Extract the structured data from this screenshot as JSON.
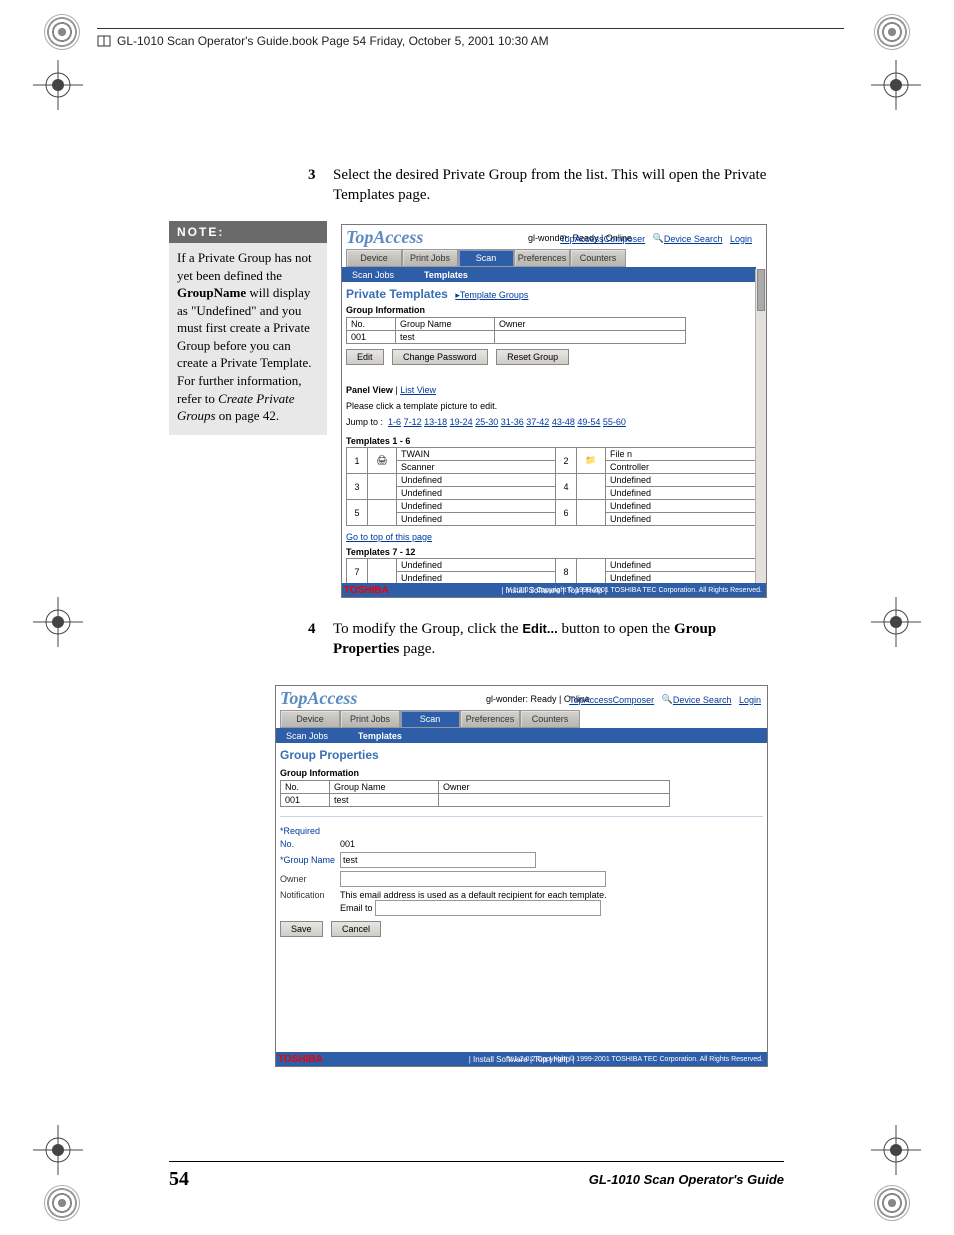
{
  "header": {
    "text": "GL-1010 Scan Operator's Guide.book   Page 54   Friday, October 5, 2001   10:30 AM"
  },
  "note": {
    "title": "NOTE:",
    "body_1": "If a Private Group has not yet been defined the ",
    "body_bold1": "GroupName",
    "body_2": " will display as \"Undefined\" and you must first create a Private Group before you can create a Private Template. For further information, refer to ",
    "body_italic": "Create Private Groups",
    "body_3": " on page 42."
  },
  "step3": {
    "num": "3",
    "text": "Select the desired Private Group from the list. This will open the Private Templates page."
  },
  "step4": {
    "num": "4",
    "text_a": "To modify the Group, click the ",
    "text_btn": "Edit...",
    "text_b": " button to open the ",
    "text_bold": "Group Properties",
    "text_c": " page."
  },
  "screenshot1": {
    "brand": "TopAccess",
    "status": "gl-wonder: Ready | Online",
    "composer": "TopAccessComposer",
    "device_search": "Device Search",
    "login": "Login",
    "tabs": {
      "device": "Device",
      "print": "Print Jobs",
      "scan": "Scan",
      "pref": "Preferences",
      "counters": "Counters"
    },
    "subtabs": {
      "scanjobs": "Scan Jobs",
      "templates": "Templates"
    },
    "title": "Private Templates",
    "back_link": "▸Template Groups",
    "group_info": "Group Information",
    "gi_h_no": "No.",
    "gi_h_name": "Group Name",
    "gi_h_owner": "Owner",
    "gi_no": "001",
    "gi_name": "test",
    "gi_owner": "",
    "btn_edit": "Edit",
    "btn_cpw": "Change Password",
    "btn_reset": "Reset Group",
    "panel_view": "Panel View",
    "list_view": "List View",
    "instr": "Please click a template picture to edit.",
    "jump": "Jump to :",
    "jump_links": [
      "1-6",
      "7-12",
      "13-18",
      "19-24",
      "25-30",
      "31-36",
      "37-42",
      "43-48",
      "49-54",
      "55-60"
    ],
    "tpl16": "Templates  1 - 6",
    "tpl712": "Templates  7 - 12",
    "r1a": "TWAIN",
    "r1b": "Scanner",
    "r2a": "File n",
    "r2b": "Controller",
    "r3a": "Undefined",
    "r3b": "Undefined",
    "r4a": "Undefined",
    "r4b": "Undefined",
    "r5a": "Undefined",
    "r5b": "Undefined",
    "r6a": "Undefined",
    "r6b": "Undefined",
    "gototop": "Go to top of this page",
    "r7a": "Undefined",
    "r7b": "Undefined",
    "r8a": "Undefined",
    "r8b": "Undefined",
    "footer_links": "|  Install Software  |  Top  |  Help  |",
    "copyright": "V.1.2.0.2  Copyright © 1999-2001 TOSHIBA TEC Corporation. All Rights Reserved.",
    "toshiba": "TOSHIBA"
  },
  "screenshot2": {
    "brand": "TopAccess",
    "status": "gl-wonder: Ready | Online",
    "composer": "TopAccessComposer",
    "device_search": "Device Search",
    "login": "Login",
    "tabs": {
      "device": "Device",
      "print": "Print Jobs",
      "scan": "Scan",
      "pref": "Preferences",
      "counters": "Counters"
    },
    "subtabs": {
      "scanjobs": "Scan Jobs",
      "templates": "Templates"
    },
    "title": "Group Properties",
    "group_info": "Group Information",
    "gi_h_no": "No.",
    "gi_h_name": "Group Name",
    "gi_h_owner": "Owner",
    "gi_no": "001",
    "gi_name": "test",
    "gi_owner": "",
    "required": "*Required",
    "f_no_l": "No.",
    "f_no_v": "001",
    "f_name_l": "*Group Name",
    "f_name_v": "test",
    "f_owner_l": "Owner",
    "f_owner_v": "",
    "f_notif_l": "Notification",
    "f_notif_txt": "This email address is used as a default recipient for each template.",
    "f_email_l": "Email to",
    "btn_save": "Save",
    "btn_cancel": "Cancel",
    "footer_links": "|  Install Software  |  Top  |  Help  |",
    "copyright": "V.1.2.0.2  Copyright © 1999-2001 TOSHIBA TEC Corporation. All Rights Reserved.",
    "toshiba": "TOSHIBA"
  },
  "footer": {
    "page_num": "54",
    "guide": "GL-1010 Scan Operator's Guide"
  }
}
